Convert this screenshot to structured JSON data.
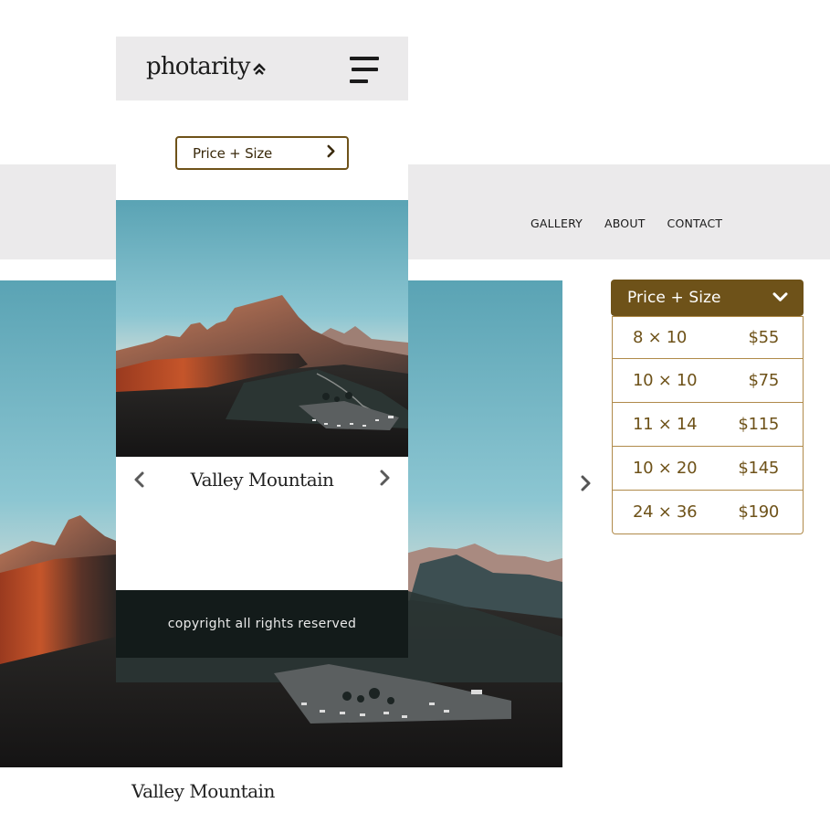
{
  "desktop": {
    "nav": {
      "items": [
        "GALLERY",
        "ABOUT",
        "CONTACT"
      ]
    },
    "photo": {
      "caption": "Valley Mountain"
    },
    "price_panel": {
      "header_label": "Price + Size",
      "rows": [
        {
          "size": "8 × 10",
          "price": "$55"
        },
        {
          "size": "10 × 10",
          "price": "$75"
        },
        {
          "size": "11 × 14",
          "price": "$115"
        },
        {
          "size": "10 × 20",
          "price": "$145"
        },
        {
          "size": "24 × 36",
          "price": "$190"
        }
      ]
    }
  },
  "mobile": {
    "logo": "photarity",
    "price_button_label": "Price + Size",
    "photo_caption": "Valley Mountain",
    "footer": "copyright all rights reserved"
  },
  "colors": {
    "brand_brown": "#6e5219",
    "nav_bg": "#ebeaeb",
    "footer_bg": "#131b1a",
    "border_tan": "#b08a4a"
  },
  "icons": [
    "logo-mark-icon",
    "hamburger-menu-icon",
    "chevron-right-icon",
    "chevron-left-icon",
    "chevron-down-icon"
  ]
}
